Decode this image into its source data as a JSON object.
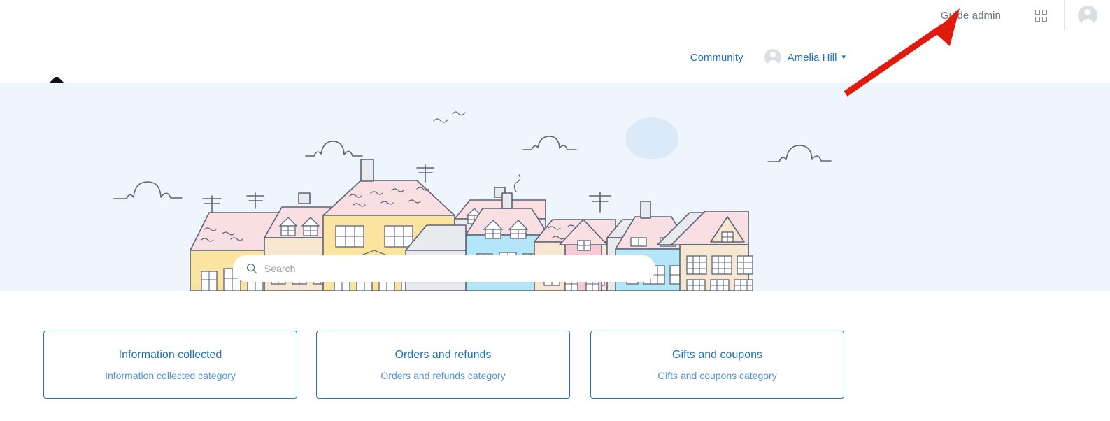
{
  "topbar": {
    "admin_label": "Guide admin",
    "products_icon": "grid-apps-icon",
    "avatar_icon": "user-avatar-icon"
  },
  "header": {
    "logo_icon": "lifebuoy-logo-icon",
    "nav": [
      {
        "label": "Community"
      }
    ],
    "user": {
      "name": "Amelia Hill",
      "avatar_icon": "user-avatar-icon",
      "chevron_icon": "chevron-down-icon"
    }
  },
  "hero": {
    "background_color": "#eef5fc",
    "illustration": "town-skyline-illustration",
    "search": {
      "icon": "search-icon",
      "placeholder": "Search",
      "value": ""
    }
  },
  "categories": [
    {
      "title": "Information collected",
      "subtitle": "Information collected category"
    },
    {
      "title": "Orders and refunds",
      "subtitle": "Orders and refunds category"
    },
    {
      "title": "Gifts and coupons",
      "subtitle": "Gifts and coupons category"
    }
  ],
  "annotation": {
    "arrow_icon": "red-pointer-arrow",
    "color": "#e01b0d",
    "points_to": "Guide admin"
  },
  "colors": {
    "link_blue": "#1f73b7",
    "sub_blue": "#5293d4",
    "hero_blue": "#eef5fc",
    "muted_gray": "#68737d",
    "annotation_red": "#e01b0d"
  }
}
